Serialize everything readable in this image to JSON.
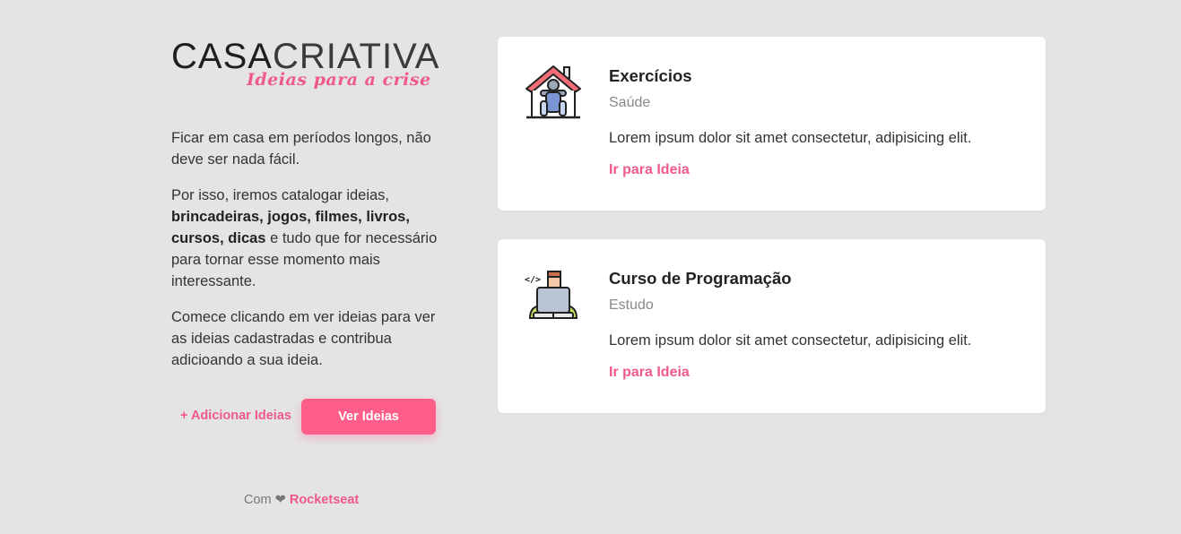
{
  "logo": {
    "part_bold": "CASA",
    "part_light": "CRIATIVA",
    "tagline": "Ideias para a crise"
  },
  "intro": {
    "p1": "Ficar em casa em períodos longos, não deve ser nada fácil.",
    "p2_prefix": "Por isso, iremos catalogar ideias, ",
    "p2_bold": "brincadeiras, jogos, filmes, livros, cursos, dicas",
    "p2_suffix": " e tudo que for necessário para tornar esse momento mais interessante.",
    "p3": "Comece clicando em ver ideias para ver as ideias cadastradas e contribua adicioando a sua ideia."
  },
  "actions": {
    "add_label": "+ Adicionar Ideias",
    "see_label": "Ver Ideias"
  },
  "footer": {
    "prefix": "Com",
    "heart": "❤",
    "brand": "Rocketseat"
  },
  "ideas": [
    {
      "title": "Exercícios",
      "category": "Saúde",
      "description": "Lorem ipsum dolor sit amet consectetur, adipisicing elit.",
      "link": "Ir para Ideia",
      "icon": "home-exercise-icon"
    },
    {
      "title": "Curso de Programação",
      "category": "Estudo",
      "description": "Lorem ipsum dolor sit amet consectetur, adipisicing elit.",
      "link": "Ir para Ideia",
      "icon": "programmer-icon"
    }
  ],
  "colors": {
    "accent": "#ff5e8a",
    "background": "#e4e4e4",
    "card": "#ffffff"
  }
}
